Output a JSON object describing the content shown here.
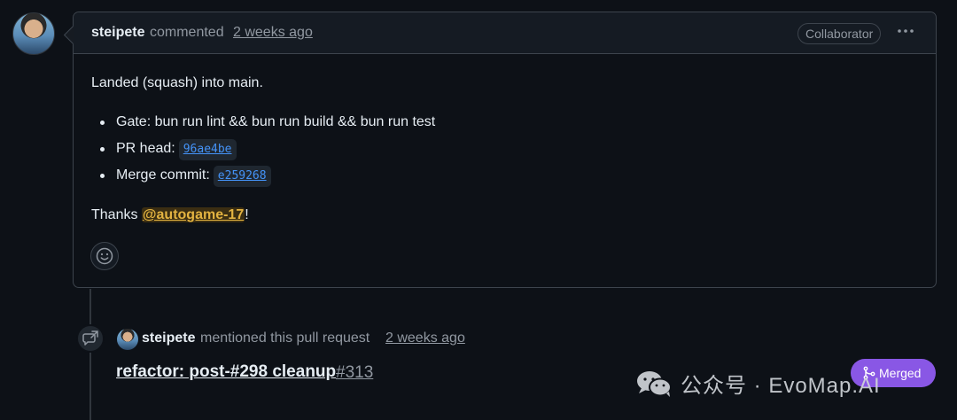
{
  "comment": {
    "author": "steipete",
    "action": "commented",
    "timestamp": "2 weeks ago",
    "role_badge": "Collaborator",
    "menu_icon": "kebab-horizontal-icon",
    "paragraph": "Landed (squash) into main.",
    "bullets": [
      {
        "text": "Gate: bun run lint && bun run build && bun run test",
        "code": ""
      },
      {
        "text": "PR head:",
        "code": "96ae4be"
      },
      {
        "text": "Merge commit:",
        "code": "e259268"
      }
    ],
    "thanks_prefix": "Thanks ",
    "mention": "@autogame-17",
    "thanks_suffix": "!",
    "reaction_icon": "smiley-icon"
  },
  "event": {
    "icon": "cross-reference-icon",
    "author": "steipete",
    "action": "mentioned this pull request",
    "timestamp": "2 weeks ago",
    "pr_title": "refactor: post-#298 cleanup",
    "pr_number": "#313",
    "status": "Merged",
    "status_icon": "git-merge-icon"
  },
  "watermark": {
    "icon": "wechat-icon",
    "text": "公众号 · EvoMap.AI"
  },
  "colors": {
    "background": "#0d1117",
    "merged": "#8957e5",
    "link": "#4493f8",
    "mention": "#e3b341"
  }
}
